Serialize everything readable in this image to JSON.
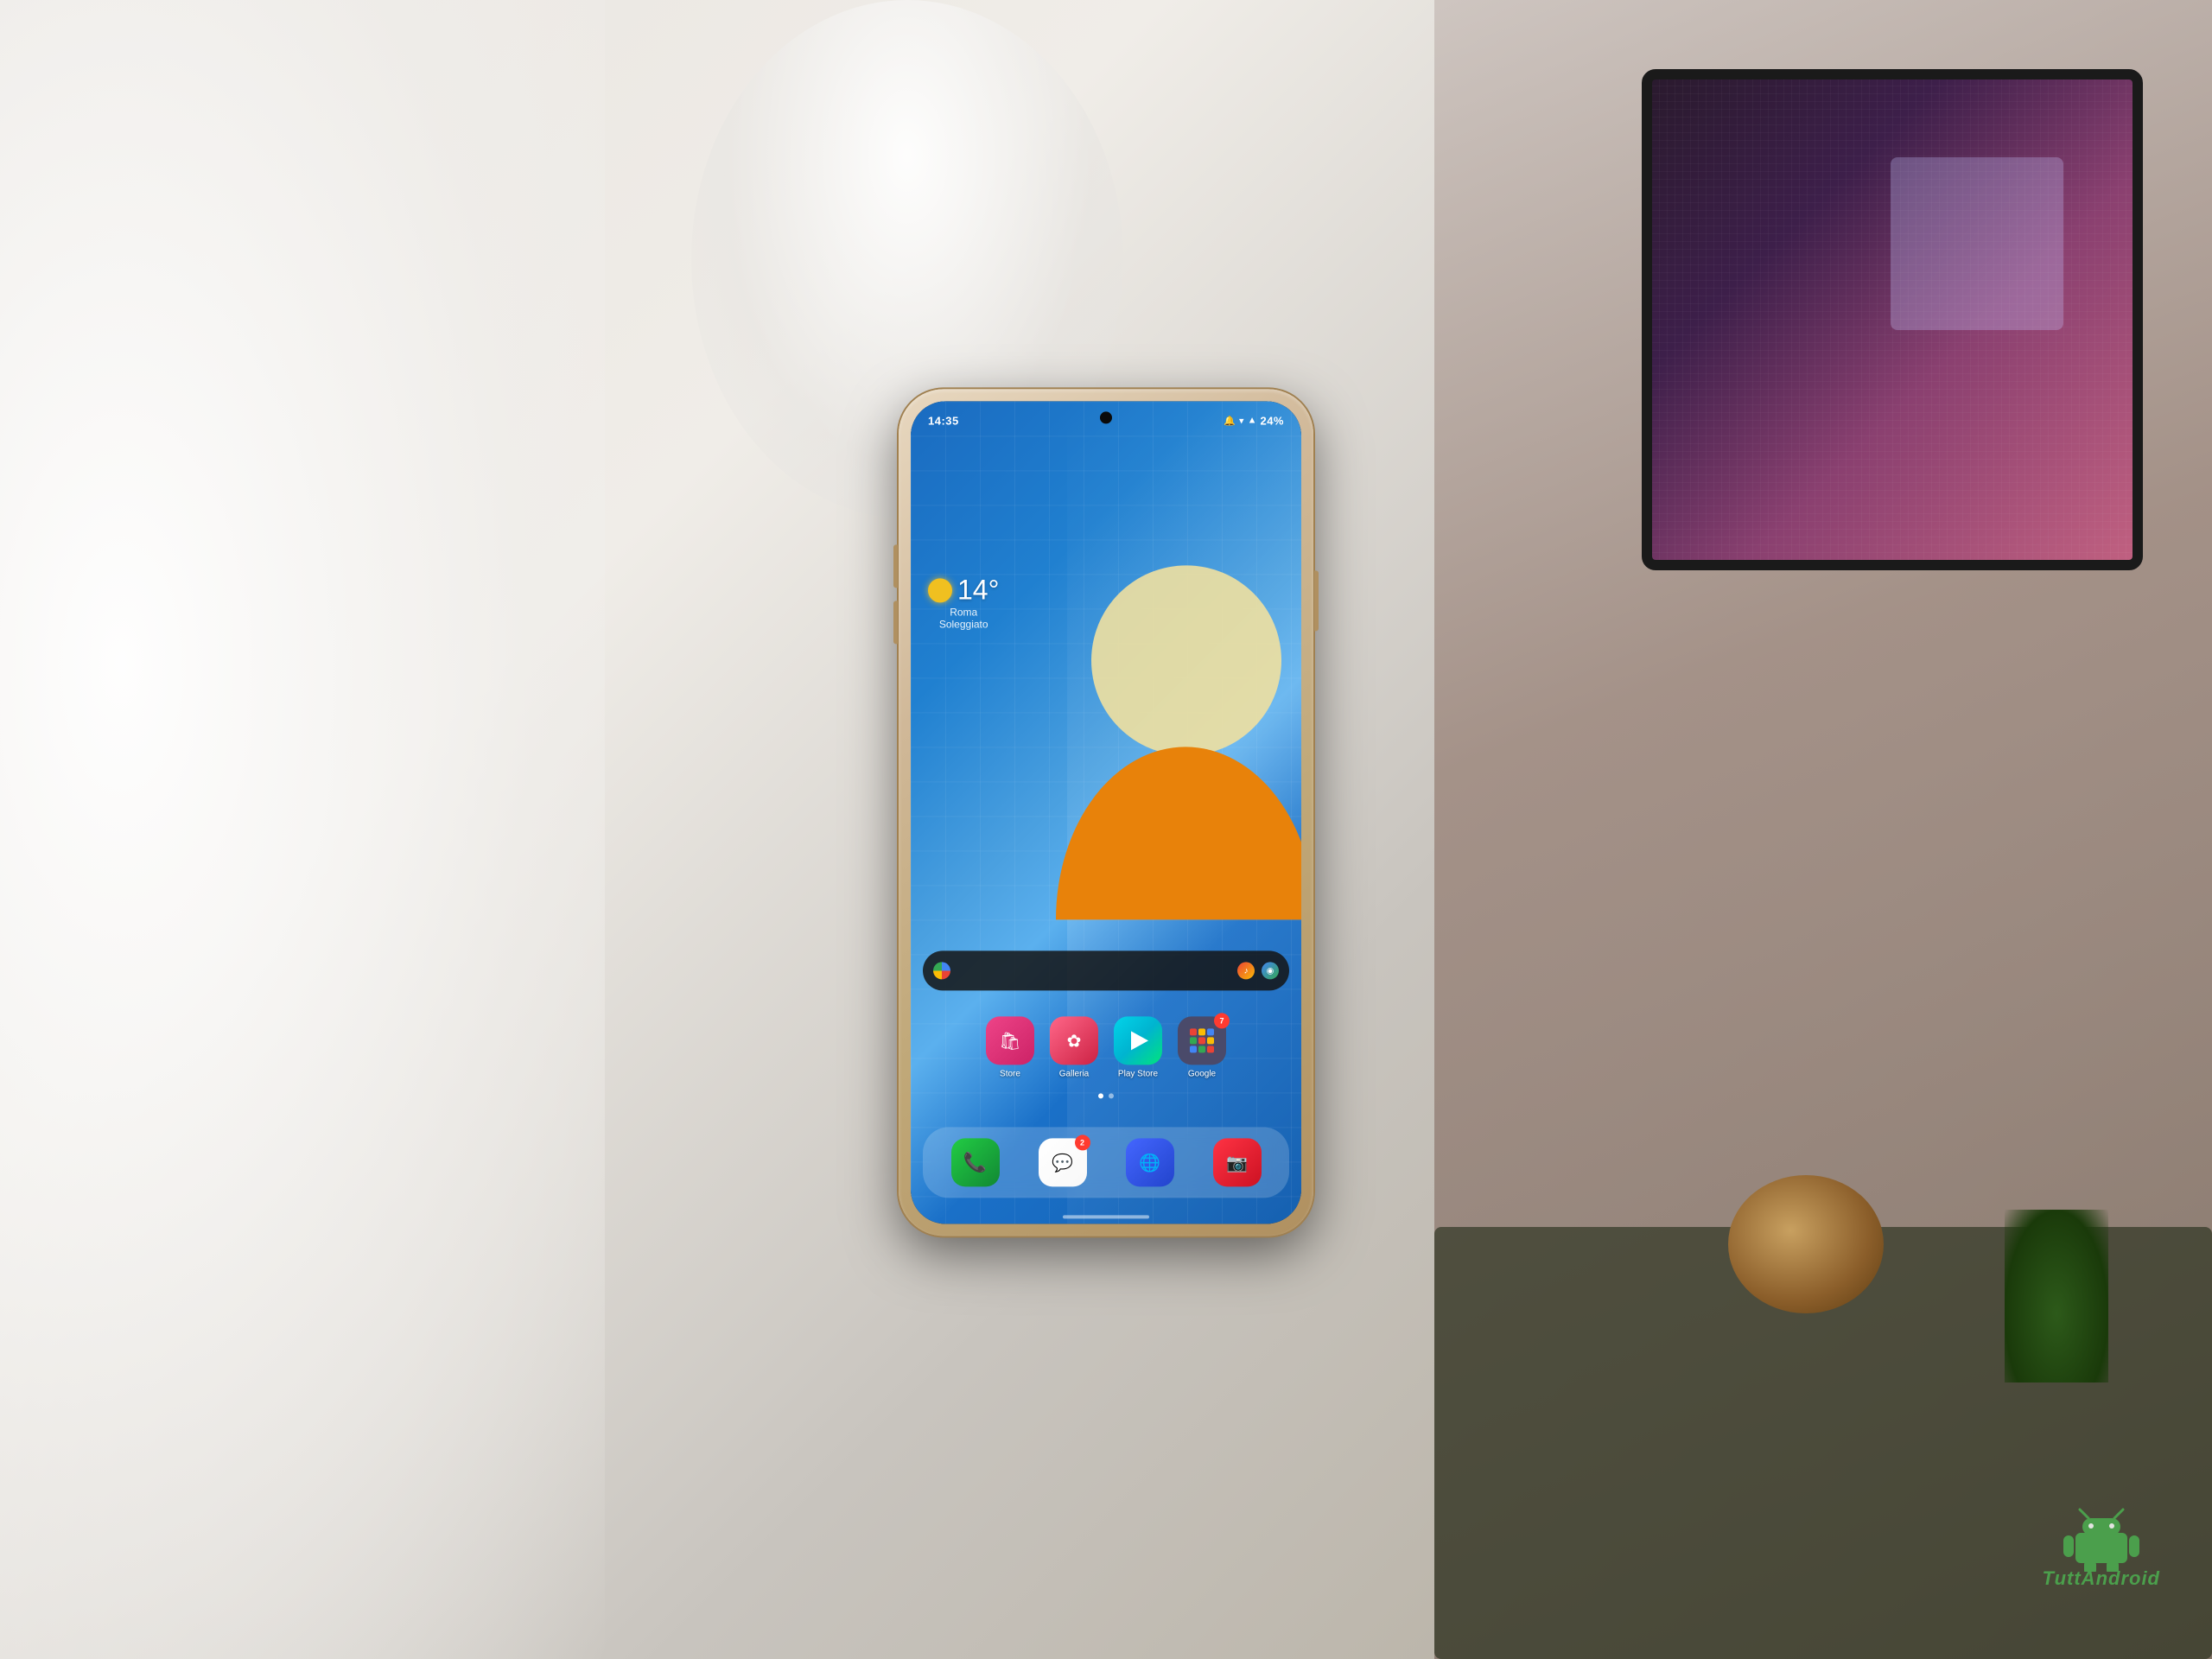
{
  "scene": {
    "background_desc": "Photo of a hand holding a Samsung Galaxy phone in front of a desk with monitor"
  },
  "phone": {
    "status_bar": {
      "time": "14:35",
      "battery": "24%",
      "signal_icons": "▲◄ 🔔 ⓦ ⓛ"
    },
    "weather": {
      "temperature": "14°",
      "location": "Roma",
      "condition": "Soleggiato",
      "icon": "sun"
    },
    "search_bar": {
      "placeholder": ""
    },
    "apps": [
      {
        "id": "store",
        "label": "Store",
        "icon_type": "store",
        "badge": null
      },
      {
        "id": "galleria",
        "label": "Galleria",
        "icon_type": "galleria",
        "badge": null
      },
      {
        "id": "play-store",
        "label": "Play Store",
        "icon_type": "playstore",
        "badge": null
      },
      {
        "id": "google",
        "label": "Google",
        "icon_type": "google",
        "badge": "7"
      }
    ],
    "dock": [
      {
        "id": "phone",
        "label": "",
        "icon_type": "phone-dock",
        "badge": null
      },
      {
        "id": "messages",
        "label": "",
        "icon_type": "messages-dock",
        "badge": "2"
      },
      {
        "id": "internet",
        "label": "",
        "icon_type": "internet-dock",
        "badge": null
      },
      {
        "id": "camera",
        "label": "",
        "icon_type": "camera-dock",
        "badge": null
      }
    ],
    "page_dots": [
      {
        "active": true
      },
      {
        "active": false
      }
    ]
  },
  "brand": {
    "name": "TuttAndroid",
    "color": "#4caf50"
  }
}
